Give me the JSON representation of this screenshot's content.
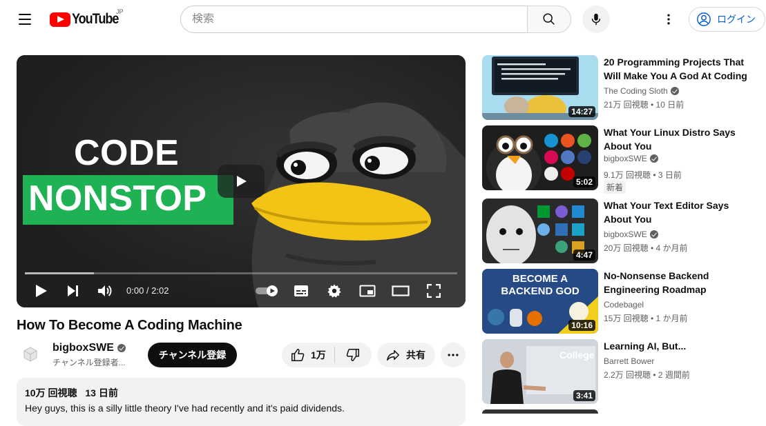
{
  "header": {
    "logo_text": "YouTube",
    "country_code": "JP",
    "search_placeholder": "検索",
    "login_label": "ログイン"
  },
  "player": {
    "thumb_line1": "CODE",
    "thumb_line2": "NONSTOP",
    "time_display": "0:00 / 2:02",
    "progress": 0.16
  },
  "video": {
    "title": "How To Become A Coding Machine",
    "channel": "bigboxSWE",
    "subscribers": "チャンネル登録者...",
    "subscribe_label": "チャンネル登録",
    "likes": "1万",
    "share_label": "共有",
    "views": "10万 回視聴",
    "age": "13 日前",
    "description": "Hey guys, this is a silly little theory I've had recently and it's paid dividends."
  },
  "colors": {
    "brand_red": "#ff0000",
    "link_blue": "#065fd4",
    "nonstop_green": "#1fb254"
  },
  "recommendations": [
    {
      "title": "20 Programming Projects That Will Make You A God At Coding",
      "channel": "The Coding Sloth",
      "verified": true,
      "meta": "21万 回視聴 • 10 日前",
      "duration": "14:27",
      "badge": ""
    },
    {
      "title": "What Your Linux Distro Says About You",
      "channel": "bigboxSWE",
      "verified": true,
      "meta": "9.1万 回視聴 • 3 日前",
      "duration": "5:02",
      "badge": "新着"
    },
    {
      "title": "What Your Text Editor Says About You",
      "channel": "bigboxSWE",
      "verified": true,
      "meta": "20万 回視聴 • 4 か月前",
      "duration": "4:47",
      "badge": ""
    },
    {
      "title": "No-Nonsense Backend Engineering Roadmap",
      "channel": "Codebagel",
      "verified": false,
      "meta": "15万 回視聴 • 1 か月前",
      "duration": "10:16",
      "badge": "",
      "thumb_text": "BECOME A BACKEND GOD"
    },
    {
      "title": "Learning AI, But...",
      "channel": "Barrett Bower",
      "verified": false,
      "meta": "2.2万 回視聴 • 2 週間前",
      "duration": "3:41",
      "badge": "",
      "thumb_text": "College"
    }
  ]
}
